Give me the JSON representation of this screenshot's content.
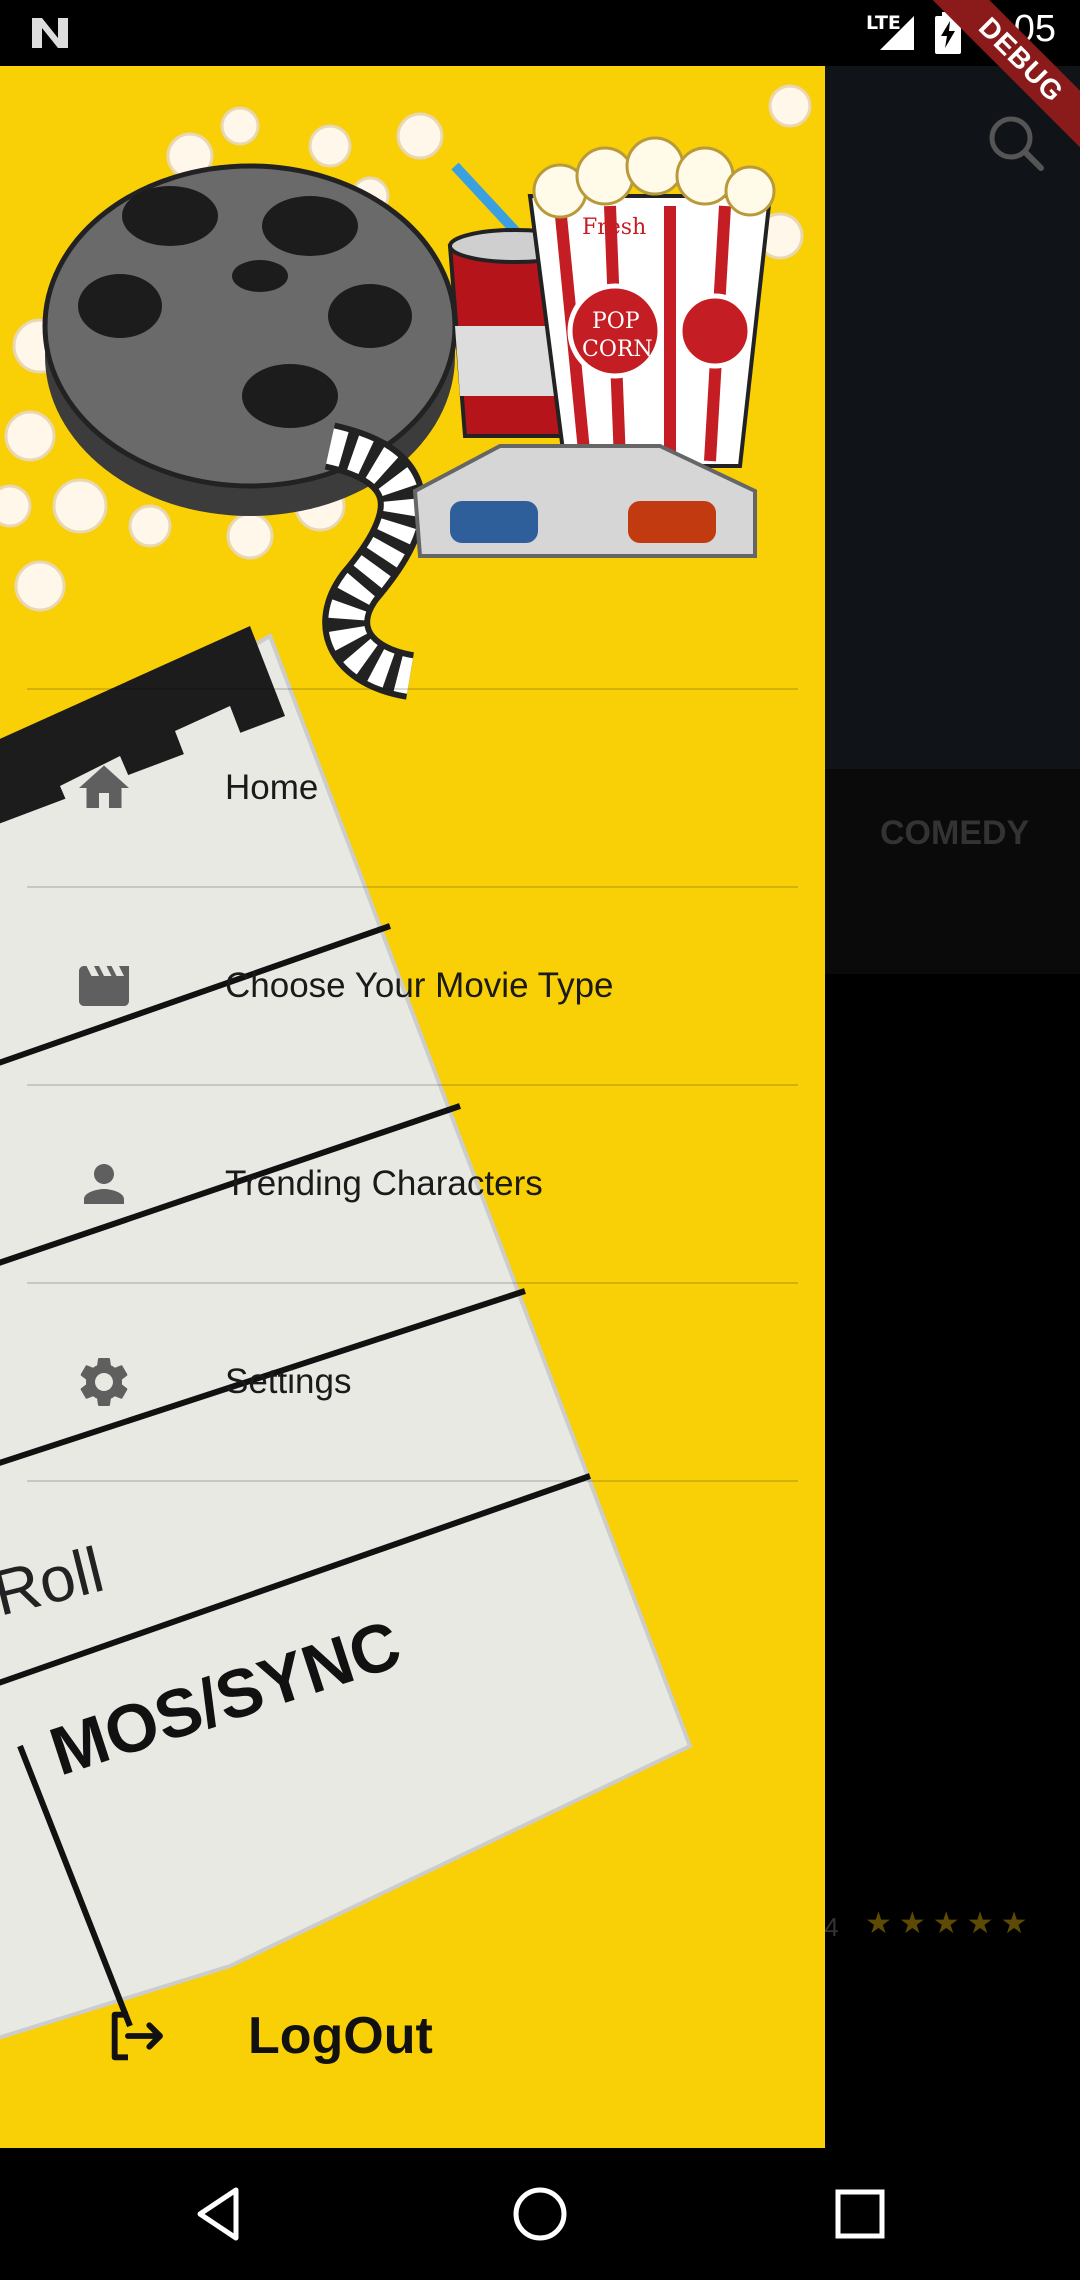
{
  "status_bar": {
    "time": "7:05",
    "network": "LTE",
    "debug_label": "DEBUG"
  },
  "drawer": {
    "menu": [
      {
        "label": "Home",
        "icon": "home-icon"
      },
      {
        "label": "Choose Your Movie Type",
        "icon": "movie-icon"
      },
      {
        "label": "Trending Characters",
        "icon": "person-icon"
      },
      {
        "label": "Settings",
        "icon": "gear-icon"
      }
    ],
    "logout_label": "LogOut",
    "background_text": {
      "clapper_roll": "Roll",
      "clapper_sync": "MOS/SYNC"
    },
    "popcorn_text": {
      "fresh": "Fresh",
      "pop": "POP",
      "corn": "CORN"
    }
  },
  "background_app": {
    "tab_label": "COMEDY",
    "rating_partial": ".4",
    "stars": "★★★★★"
  },
  "colors": {
    "drawer_bg": "#f9cf06",
    "accent_red": "#8b1a1a"
  }
}
